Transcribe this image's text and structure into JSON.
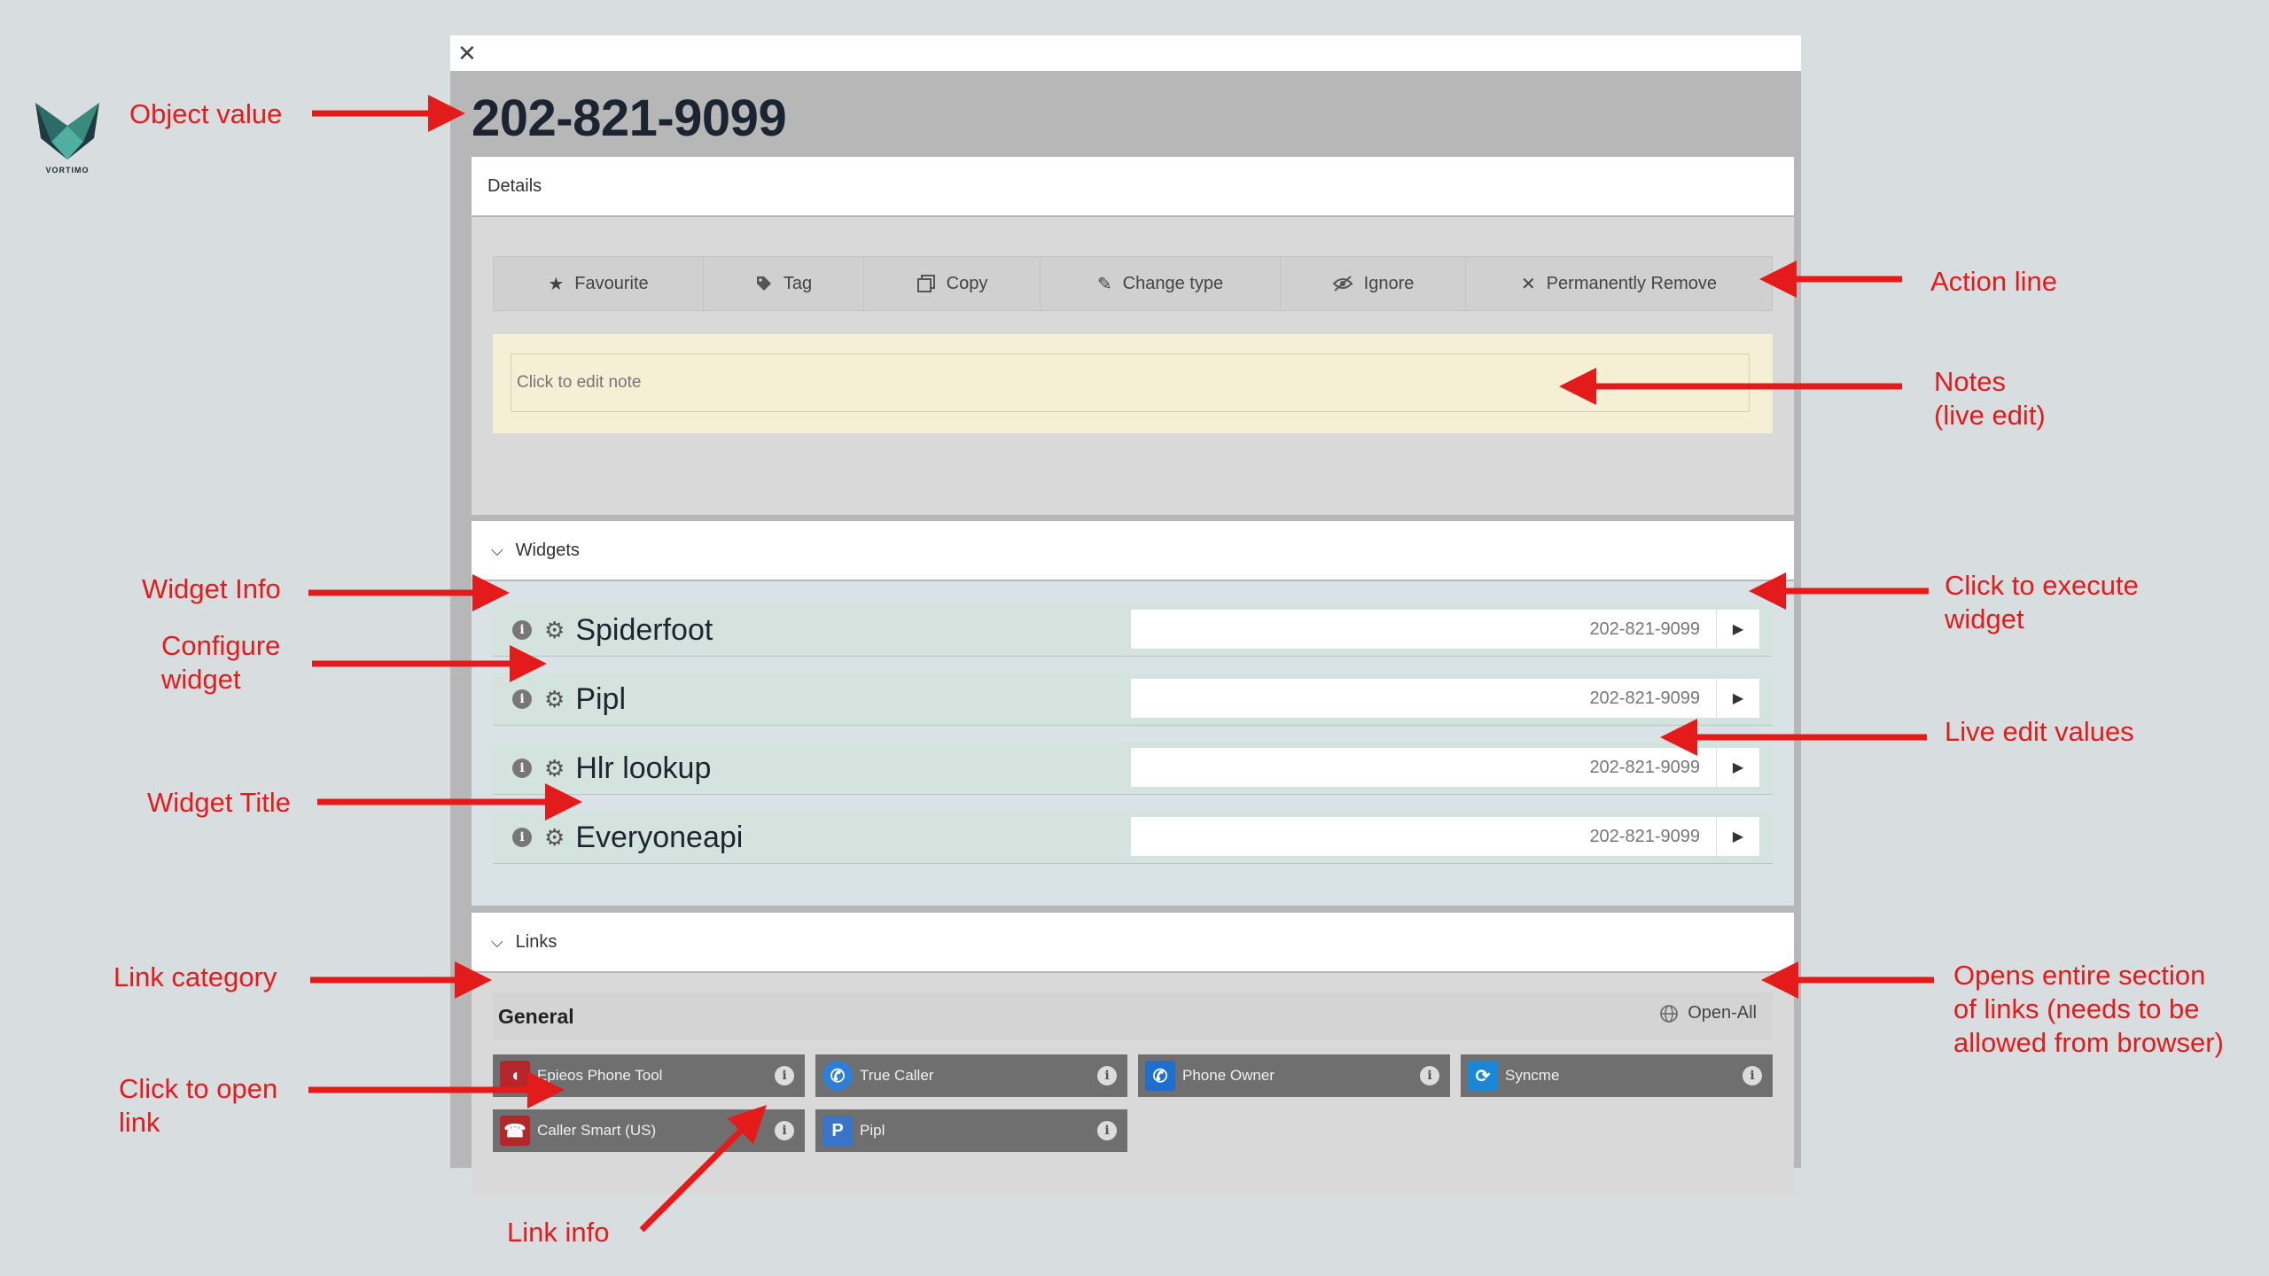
{
  "brand": {
    "logo_text": "VORTIMO"
  },
  "object_value": "202-821-9099",
  "details": {
    "title": "Details",
    "actions": [
      {
        "label": "Favourite",
        "icon": "star-icon"
      },
      {
        "label": "Tag",
        "icon": "tag-icon"
      },
      {
        "label": "Copy",
        "icon": "copy-icon"
      },
      {
        "label": "Change type",
        "icon": "pencil-icon"
      },
      {
        "label": "Ignore",
        "icon": "eye-slash-icon"
      },
      {
        "label": "Permanently Remove",
        "icon": "close-icon"
      }
    ],
    "note_placeholder": "Click to edit note"
  },
  "widgets": {
    "title": "Widgets",
    "items": [
      {
        "title": "Spiderfoot",
        "value": "202-821-9099"
      },
      {
        "title": "Pipl",
        "value": "202-821-9099"
      },
      {
        "title": "Hlr lookup",
        "value": "202-821-9099"
      },
      {
        "title": "Everyoneapi",
        "value": "202-821-9099"
      }
    ]
  },
  "links": {
    "title": "Links",
    "category": "General",
    "open_all": "Open-All",
    "items": [
      {
        "label": "Epieos Phone Tool",
        "icon_color": "#b3262a",
        "icon": "epieos-icon"
      },
      {
        "label": "True Caller",
        "icon_color": "#2f7fd8",
        "icon": "phone-icon"
      },
      {
        "label": "Phone Owner",
        "icon_color": "#1e6fd0",
        "icon": "phone-icon"
      },
      {
        "label": "Syncme",
        "icon_color": "#1a86d6",
        "icon": "sync-icon"
      },
      {
        "label": "Caller Smart (US)",
        "icon_color": "#b3262a",
        "icon": "caller-smart-icon"
      },
      {
        "label": "Pipl",
        "icon_color": "#3a74c9",
        "icon": "pipl-icon"
      }
    ]
  },
  "annotations": {
    "object_value": "Object value",
    "action_line": "Action line",
    "notes_1": "Notes",
    "notes_2": "(live edit)",
    "widget_info": "Widget Info",
    "configure_1": "Configure",
    "configure_2": "widget",
    "execute_1": "Click to execute",
    "execute_2": "widget",
    "live_edit": "Live edit values",
    "widget_title": "Widget Title",
    "link_category": "Link category",
    "open_entire_1": "Opens entire section",
    "open_entire_2": "of links (needs to be",
    "open_entire_3": "allowed from browser)",
    "click_open_1": "Click to open",
    "click_open_2": "link",
    "link_info": "Link info"
  },
  "colors": {
    "annotation": "#e41b1b",
    "background": "#d8dde0",
    "widget_row": "#d5e3de",
    "note_bg": "#f5efd6"
  }
}
